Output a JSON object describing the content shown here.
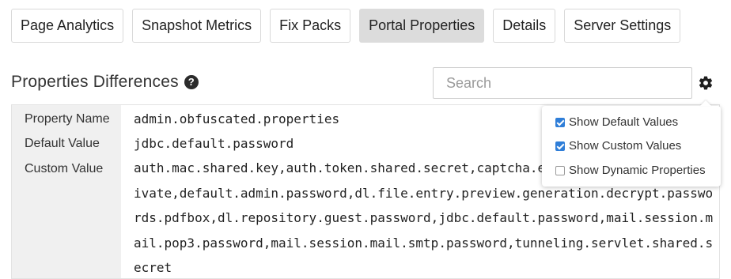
{
  "tabs": [
    {
      "label": "Page Analytics",
      "active": false
    },
    {
      "label": "Snapshot Metrics",
      "active": false
    },
    {
      "label": "Fix Packs",
      "active": false
    },
    {
      "label": "Portal Properties",
      "active": true
    },
    {
      "label": "Details",
      "active": false
    },
    {
      "label": "Server Settings",
      "active": false
    }
  ],
  "section": {
    "title": "Properties Differences",
    "help_icon": "?"
  },
  "search": {
    "placeholder": "Search",
    "value": ""
  },
  "settings_icon": "gear-icon",
  "properties": {
    "name_label": "Property Name",
    "name_value": "admin.obfuscated.properties",
    "default_label": "Default Value",
    "default_value": "jdbc.default.password",
    "custom_label": "Custom Value",
    "custom_lines": [
      "auth.mac.shared.key,auth.token.shared.secret,captcha.en",
      "ivate,default.admin.password,dl.file.entry.preview.generation.decrypt.passwo",
      "rds.pdfbox,dl.repository.guest.password,jdbc.default.password,mail.session.m",
      "ail.pop3.password,mail.session.mail.smtp.password,tunneling.servlet.shared.s",
      "ecret"
    ]
  },
  "dropdown": {
    "options": [
      {
        "label": "Show Default Values",
        "checked": true
      },
      {
        "label": "Show Custom Values",
        "checked": true
      },
      {
        "label": "Show Dynamic Properties",
        "checked": false
      }
    ]
  },
  "colors": {
    "active_tab": "#dcdcdc",
    "checkbox_accent": "#2f7ed8",
    "panel_background": "#f0f0f0"
  }
}
